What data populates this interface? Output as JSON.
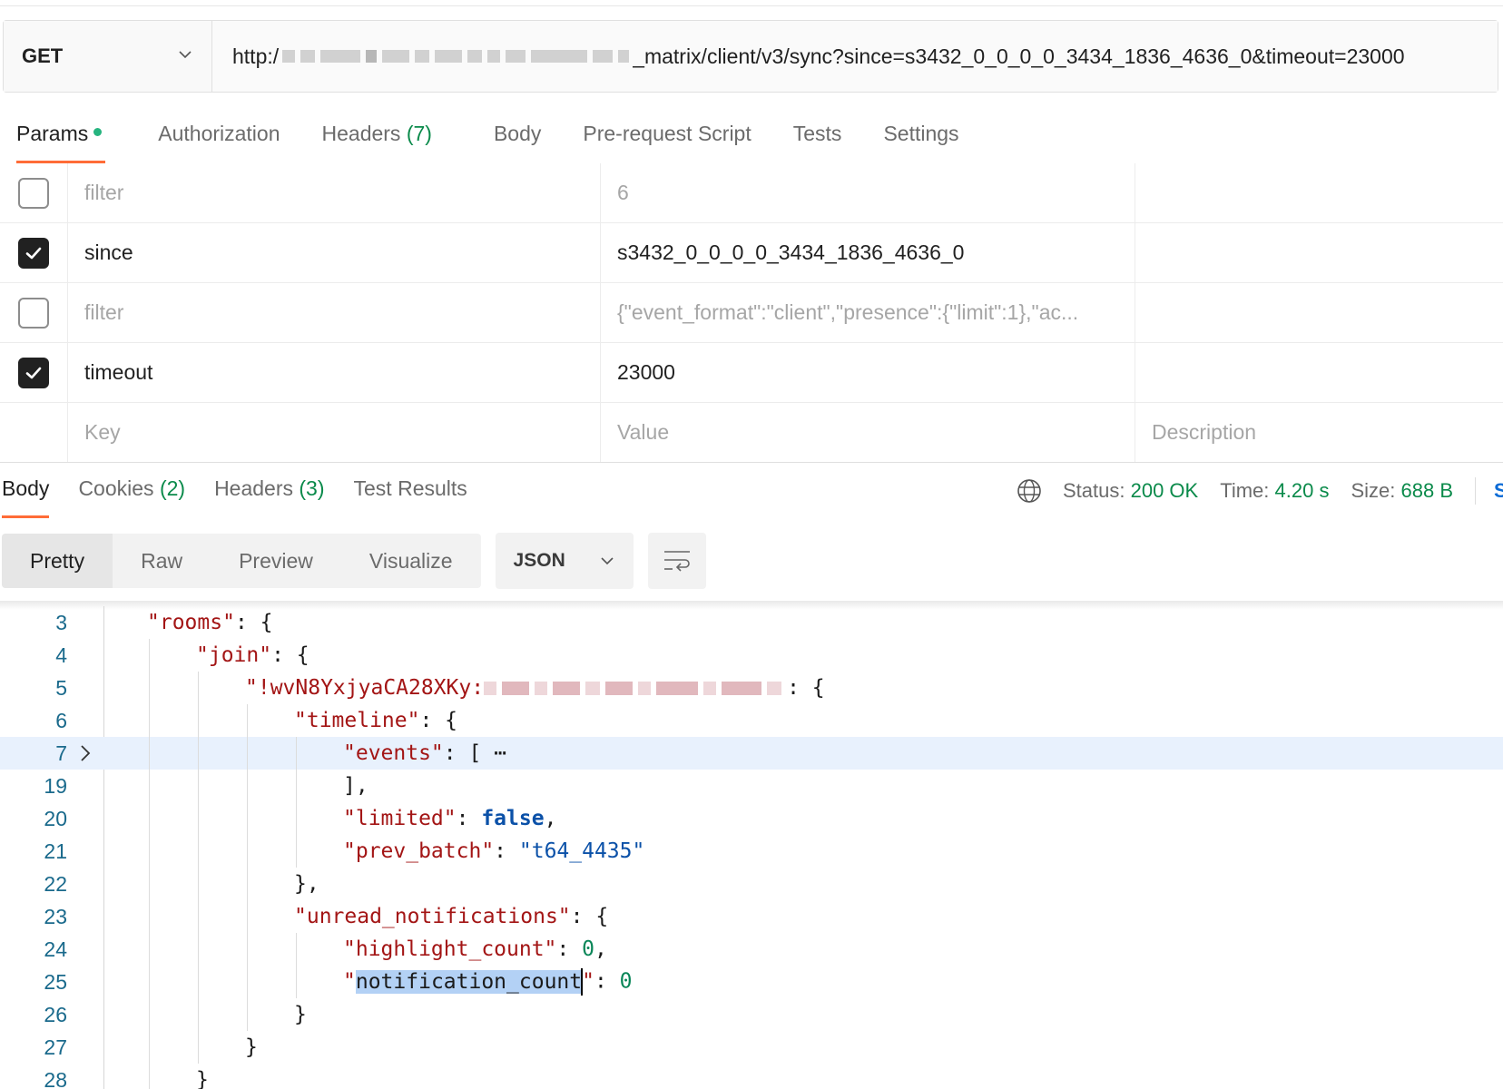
{
  "request": {
    "method": "GET",
    "url_prefix": "http:/",
    "url_suffix": "_matrix/client/v3/sync?since=s3432_0_0_0_0_3434_1836_4636_0&timeout=23000"
  },
  "request_tabs": [
    {
      "label": "Params",
      "count": "",
      "dot": true,
      "active": true
    },
    {
      "label": "Authorization",
      "count": ""
    },
    {
      "label": "Headers",
      "count": "(7)"
    },
    {
      "label": "Body",
      "count": ""
    },
    {
      "label": "Pre-request Script",
      "count": ""
    },
    {
      "label": "Tests",
      "count": ""
    },
    {
      "label": "Settings",
      "count": ""
    }
  ],
  "params": {
    "rows": [
      {
        "checked": false,
        "key": "filter",
        "value": "6",
        "description": ""
      },
      {
        "checked": true,
        "key": "since",
        "value": "s3432_0_0_0_0_3434_1836_4636_0",
        "description": ""
      },
      {
        "checked": false,
        "key": "filter",
        "value": "{\"event_format\":\"client\",\"presence\":{\"limit\":1},\"ac...",
        "description": ""
      },
      {
        "checked": true,
        "key": "timeout",
        "value": "23000",
        "description": ""
      }
    ],
    "placeholder_key": "Key",
    "placeholder_value": "Value",
    "placeholder_description": "Description"
  },
  "response_tabs": [
    {
      "label": "Body",
      "count": "",
      "active": true
    },
    {
      "label": "Cookies",
      "count": "(2)"
    },
    {
      "label": "Headers",
      "count": "(3)"
    },
    {
      "label": "Test Results",
      "count": ""
    }
  ],
  "response_meta": {
    "status_label": "Status:",
    "status_value": "200 OK",
    "time_label": "Time:",
    "time_value": "4.20 s",
    "size_label": "Size:",
    "size_value": "688 B",
    "save_label": "S"
  },
  "view_modes": [
    {
      "label": "Pretty",
      "active": true
    },
    {
      "label": "Raw"
    },
    {
      "label": "Preview"
    },
    {
      "label": "Visualize"
    }
  ],
  "format": "JSON",
  "code_lines": [
    {
      "n": "3",
      "indent": 1,
      "tokens": [
        [
          "k",
          "\"rooms\""
        ],
        [
          "p",
          ": {"
        ]
      ]
    },
    {
      "n": "4",
      "indent": 2,
      "tokens": [
        [
          "k",
          "\"join\""
        ],
        [
          "p",
          ": {"
        ]
      ]
    },
    {
      "n": "5",
      "indent": 3,
      "tokens": [
        [
          "k",
          "\"!wvN8YxjyaCA28XKy:"
        ],
        [
          "blur",
          ""
        ],
        [
          "p",
          ": {"
        ]
      ]
    },
    {
      "n": "6",
      "indent": 4,
      "tokens": [
        [
          "k",
          "\"timeline\""
        ],
        [
          "p",
          ": {"
        ]
      ]
    },
    {
      "n": "7",
      "indent": 5,
      "fold": true,
      "highlight": true,
      "tokens": [
        [
          "k",
          "\"events\""
        ],
        [
          "p",
          ": [ "
        ],
        [
          "p",
          "⋯"
        ]
      ]
    },
    {
      "n": "19",
      "indent": 5,
      "tokens": [
        [
          "p",
          "],"
        ]
      ]
    },
    {
      "n": "20",
      "indent": 5,
      "tokens": [
        [
          "k",
          "\"limited\""
        ],
        [
          "p",
          ": "
        ],
        [
          "b",
          "false"
        ],
        [
          "p",
          ","
        ]
      ]
    },
    {
      "n": "21",
      "indent": 5,
      "tokens": [
        [
          "k",
          "\"prev_batch\""
        ],
        [
          "p",
          ": "
        ],
        [
          "s",
          "\"t64_4435\""
        ]
      ]
    },
    {
      "n": "22",
      "indent": 4,
      "tokens": [
        [
          "p",
          "},"
        ]
      ]
    },
    {
      "n": "23",
      "indent": 4,
      "tokens": [
        [
          "k",
          "\"unread_notifications\""
        ],
        [
          "p",
          ": {"
        ]
      ]
    },
    {
      "n": "24",
      "indent": 5,
      "tokens": [
        [
          "k",
          "\"highlight_count\""
        ],
        [
          "p",
          ": "
        ],
        [
          "n",
          "0"
        ],
        [
          "p",
          ","
        ]
      ]
    },
    {
      "n": "25",
      "indent": 5,
      "tokens": [
        [
          "k",
          "\""
        ],
        [
          "sel",
          "notification_count"
        ],
        [
          "cursor",
          ""
        ],
        [
          "k",
          "\""
        ],
        [
          "p",
          ": "
        ],
        [
          "n",
          "0"
        ]
      ]
    },
    {
      "n": "26",
      "indent": 4,
      "tokens": [
        [
          "p",
          "}"
        ]
      ]
    },
    {
      "n": "27",
      "indent": 3,
      "tokens": [
        [
          "p",
          "}"
        ]
      ]
    },
    {
      "n": "28",
      "indent": 2,
      "tokens": [
        [
          "p",
          "}"
        ]
      ]
    }
  ]
}
